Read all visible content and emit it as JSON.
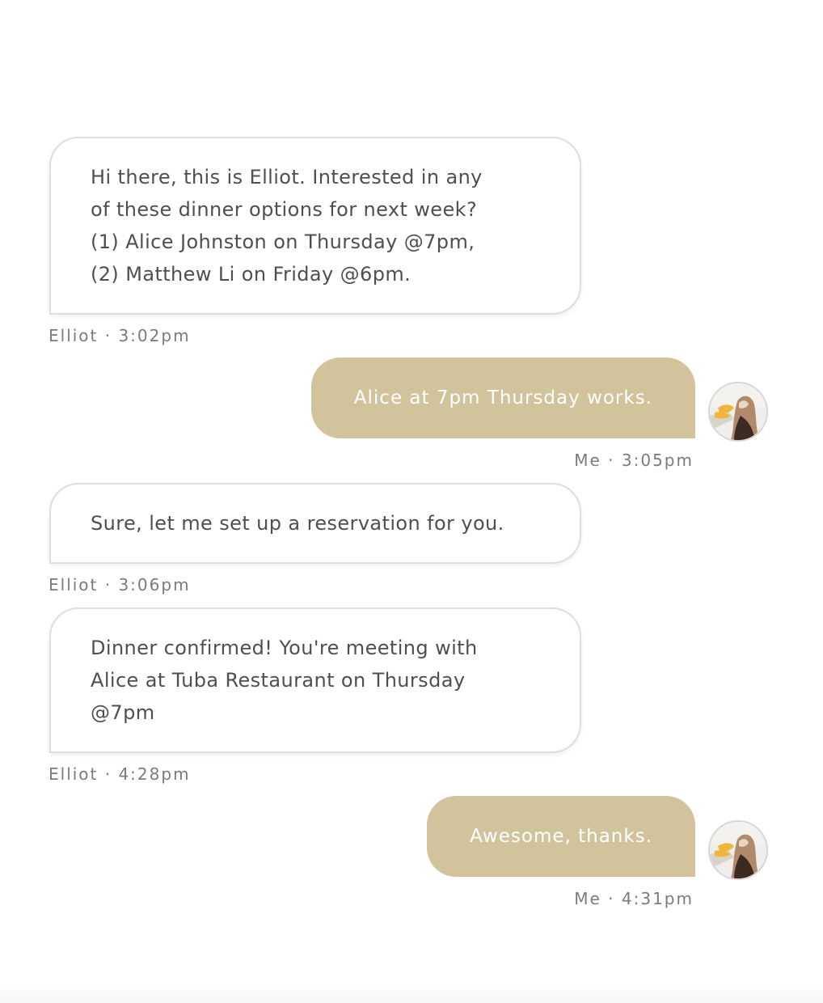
{
  "messages": [
    {
      "sender": "Elliot",
      "direction": "incoming",
      "text": "Hi there, this is Elliot. Interested in any\nof these dinner options for next week?\n(1) Alice Johnston on Thursday @7pm,\n(2) Matthew Li on Friday @6pm.",
      "meta": "Elliot · 3:02pm"
    },
    {
      "sender": "Me",
      "direction": "outgoing",
      "text": "Alice at 7pm Thursday works.",
      "meta": "Me · 3:05pm",
      "avatar": "user-avatar-photo"
    },
    {
      "sender": "Elliot",
      "direction": "incoming",
      "text": "Sure, let me set up a reservation for you.",
      "meta": "Elliot · 3:06pm"
    },
    {
      "sender": "Elliot",
      "direction": "incoming",
      "text": "Dinner confirmed! You're meeting with\nAlice at Tuba Restaurant on Thursday\n@7pm",
      "meta": "Elliot · 4:28pm"
    },
    {
      "sender": "Me",
      "direction": "outgoing",
      "text": "Awesome, thanks.",
      "meta": "Me · 4:31pm",
      "avatar": "user-avatar-photo"
    }
  ],
  "colors": {
    "outgoing_bubble": "#d1c39c",
    "incoming_bubble": "#ffffff",
    "incoming_border": "#dedede",
    "incoming_text": "#4f4f4f",
    "outgoing_text": "#ffffff",
    "meta_text": "#7b7b7b"
  }
}
